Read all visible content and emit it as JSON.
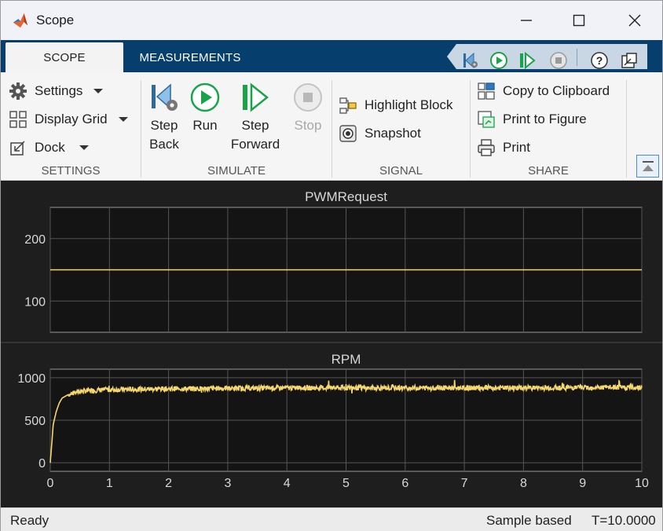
{
  "window": {
    "title": "Scope",
    "minimize_glyph": "—",
    "maximize_glyph": "☐",
    "close_glyph": "✕"
  },
  "tabs": [
    {
      "label": "SCOPE",
      "active": true
    },
    {
      "label": "MEASUREMENTS",
      "active": false
    }
  ],
  "quick_access": [
    "step-back-icon",
    "run-icon",
    "step-forward-icon",
    "stop-icon",
    "help-icon",
    "undock-icon"
  ],
  "ribbon": {
    "settings_group": {
      "label": "SETTINGS",
      "items": [
        {
          "label": "Settings",
          "icon": "gear-icon"
        },
        {
          "label": "Display Grid",
          "icon": "grid-icon"
        },
        {
          "label": "Dock",
          "icon": "dock-icon"
        }
      ]
    },
    "simulate_group": {
      "label": "SIMULATE",
      "step_back": {
        "line1": "Step",
        "line2": "Back"
      },
      "run": {
        "label": "Run"
      },
      "step_forward": {
        "line1": "Step",
        "line2": "Forward"
      },
      "stop": {
        "label": "Stop",
        "disabled": true
      }
    },
    "signal_group": {
      "label": "SIGNAL",
      "items": [
        {
          "label": "Highlight Block",
          "icon": "highlight-block-icon"
        },
        {
          "label": "Snapshot",
          "icon": "snapshot-icon"
        }
      ]
    },
    "share_group": {
      "label": "SHARE",
      "items": [
        {
          "label": "Copy to Clipboard",
          "icon": "clipboard-icon"
        },
        {
          "label": "Print to Figure",
          "icon": "print-to-figure-icon"
        },
        {
          "label": "Print",
          "icon": "printer-icon"
        }
      ]
    }
  },
  "colors": {
    "tab_strip": "#063f6e",
    "plot_bg": "#141414",
    "scope_bg": "#1e1e1e",
    "grid": "#555555",
    "trace": "#f5d76e",
    "run_green": "#1aa34a"
  },
  "chart_data": [
    {
      "type": "line",
      "title": "PWMRequest",
      "xlim": [
        0,
        10
      ],
      "ylim": [
        50,
        250
      ],
      "yticks": [
        100,
        200
      ],
      "xticks": [
        0,
        1,
        2,
        3,
        4,
        5,
        6,
        7,
        8,
        9,
        10
      ],
      "show_x_tick_labels": false,
      "grid": true,
      "series": [
        {
          "x": [
            0,
            10
          ],
          "y": [
            150,
            150
          ]
        }
      ]
    },
    {
      "type": "line",
      "title": "RPM",
      "xlim": [
        0,
        10
      ],
      "ylim": [
        -100,
        1100
      ],
      "yticks": [
        0,
        500,
        1000
      ],
      "xticks": [
        0,
        1,
        2,
        3,
        4,
        5,
        6,
        7,
        8,
        9,
        10
      ],
      "show_x_tick_labels": true,
      "grid": true,
      "noise_amplitude": 60,
      "series": [
        {
          "x": [
            0,
            0.05,
            0.1,
            0.15,
            0.2,
            0.3,
            0.4,
            0.5,
            0.7,
            1,
            2,
            3,
            4,
            5,
            6,
            7,
            8,
            9,
            10
          ],
          "y": [
            0,
            450,
            600,
            700,
            760,
            800,
            820,
            840,
            850,
            860,
            870,
            875,
            880,
            880,
            880,
            880,
            880,
            885,
            885
          ]
        }
      ]
    }
  ],
  "status": {
    "left": "Ready",
    "mode": "Sample based",
    "time": "T=10.0000"
  }
}
